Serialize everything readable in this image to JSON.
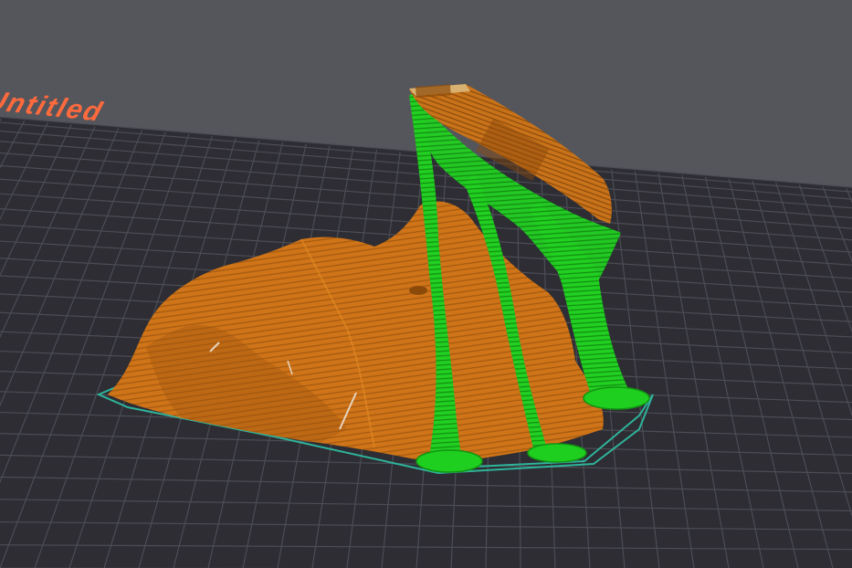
{
  "viewport": {
    "plate_name": "Untitled"
  },
  "colors": {
    "background": "#55565c",
    "bed": "#2d2d33",
    "grid": "#4a4b52",
    "plate_label": "#ff6a3d",
    "model": "#cf7418",
    "model_dark": "#9a520d",
    "support": "#1fcf1f",
    "support_dark": "#129412",
    "skirt": "#2fb39a"
  },
  "icons": {
    "model": "sliced-model",
    "supports": "tree-supports"
  }
}
